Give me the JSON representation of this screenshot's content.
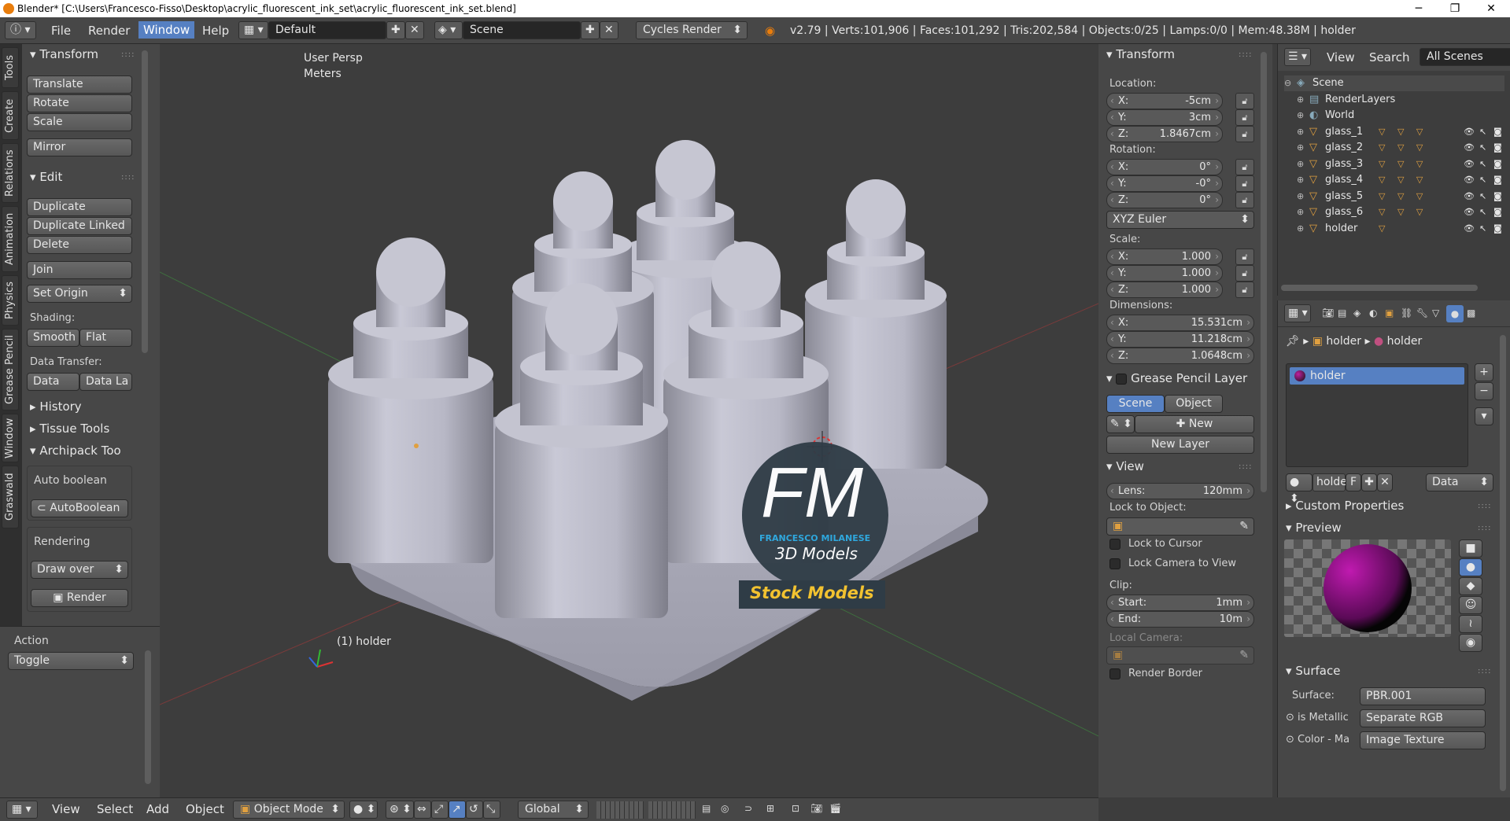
{
  "titlebar": {
    "title": "Blender* [C:\\Users\\Francesco-Fisso\\Desktop\\acrylic_fluorescent_ink_set\\acrylic_fluorescent_ink_set.blend]",
    "minimize": "─",
    "maximize": "❐",
    "close": "✕"
  },
  "menu": {
    "file": "File",
    "render": "Render",
    "window": "Window",
    "help": "Help"
  },
  "header": {
    "layout": "Default",
    "scene": "Scene",
    "engine": "Cycles Render",
    "stats": "v2.79 | Verts:101,906 | Faces:101,292 | Tris:202,584 | Objects:0/25 | Lamps:0/0 | Mem:48.38M | holder"
  },
  "vtabs": [
    "Tools",
    "Create",
    "Relations",
    "Animation",
    "Physics",
    "Grease Pencil",
    "Window",
    "Graswald"
  ],
  "tools": {
    "transform_title": "Transform",
    "translate": "Translate",
    "rotate": "Rotate",
    "scale": "Scale",
    "mirror": "Mirror",
    "edit_title": "Edit",
    "duplicate": "Duplicate",
    "duplicate_linked": "Duplicate Linked",
    "delete": "Delete",
    "join": "Join",
    "set_origin": "Set Origin",
    "shading_label": "Shading:",
    "smooth": "Smooth",
    "flat": "Flat",
    "data_transfer_label": "Data Transfer:",
    "data": "Data",
    "data_la": "Data La",
    "history": "History",
    "tissue": "Tissue Tools",
    "archipack": "Archipack Too",
    "auto_boolean_label": "Auto boolean",
    "auto_boolean_btn": "AutoBoolean",
    "rendering_label": "Rendering",
    "draw_over": "Draw over",
    "render_btn": "Render",
    "action_label": "Action",
    "toggle": "Toggle"
  },
  "viewport": {
    "persp": "User Persp",
    "units": "Meters",
    "object_label": "(1) holder",
    "logo_fm": "FM",
    "logo_name": "FRANCESCO MILANESE",
    "logo_3d": "3D Models",
    "stock": "Stock Models"
  },
  "props": {
    "transform_title": "Transform",
    "location_label": "Location:",
    "loc": [
      {
        "k": "X:",
        "v": "-5cm"
      },
      {
        "k": "Y:",
        "v": "3cm"
      },
      {
        "k": "Z:",
        "v": "1.8467cm"
      }
    ],
    "rotation_label": "Rotation:",
    "rot": [
      {
        "k": "X:",
        "v": "0°"
      },
      {
        "k": "Y:",
        "v": "-0°"
      },
      {
        "k": "Z:",
        "v": "0°"
      }
    ],
    "euler": "XYZ Euler",
    "scale_label": "Scale:",
    "scale": [
      {
        "k": "X:",
        "v": "1.000"
      },
      {
        "k": "Y:",
        "v": "1.000"
      },
      {
        "k": "Z:",
        "v": "1.000"
      }
    ],
    "dim_label": "Dimensions:",
    "dim": [
      {
        "k": "X:",
        "v": "15.531cm"
      },
      {
        "k": "Y:",
        "v": "11.218cm"
      },
      {
        "k": "Z:",
        "v": "1.0648cm"
      }
    ],
    "gp_title": "Grease Pencil Layer",
    "scene_tab": "Scene",
    "object_tab": "Object",
    "new": "New",
    "new_layer": "New Layer",
    "view_title": "View",
    "lens_k": "Lens:",
    "lens_v": "120mm",
    "lock_obj": "Lock to Object:",
    "lock_cursor": "Lock to Cursor",
    "lock_camera": "Lock Camera to View",
    "clip_label": "Clip:",
    "start_k": "Start:",
    "start_v": "1mm",
    "end_k": "End:",
    "end_v": "10m",
    "local_camera": "Local Camera:",
    "render_border": "Render Border"
  },
  "outliner": {
    "view": "View",
    "search": "Search",
    "all_scenes": "All Scenes",
    "items": [
      {
        "name": "Scene"
      },
      {
        "name": "RenderLayers"
      },
      {
        "name": "World"
      },
      {
        "name": "glass_1"
      },
      {
        "name": "glass_2"
      },
      {
        "name": "glass_3"
      },
      {
        "name": "glass_4"
      },
      {
        "name": "glass_5"
      },
      {
        "name": "glass_6"
      },
      {
        "name": "holder"
      }
    ]
  },
  "material": {
    "breadcrumb_obj": "holder",
    "breadcrumb_mat": "holder",
    "slot": "holder",
    "name": "holde",
    "f": "F",
    "data": "Data",
    "custom_props": "Custom Properties",
    "preview": "Preview",
    "surface_title": "Surface",
    "surface_k": "Surface:",
    "surface_v": "PBR.001",
    "metallic_k": "is Metallic",
    "metallic_v": "Separate RGB",
    "color_k": "Color - Ma",
    "color_v": "Image Texture"
  },
  "bottom": {
    "view": "View",
    "select": "Select",
    "add": "Add",
    "object": "Object",
    "mode": "Object Mode",
    "orientation": "Global"
  },
  "colors": {
    "accent": "#5680c2",
    "panel": "#474747",
    "viewport": "#3d3d3d"
  }
}
